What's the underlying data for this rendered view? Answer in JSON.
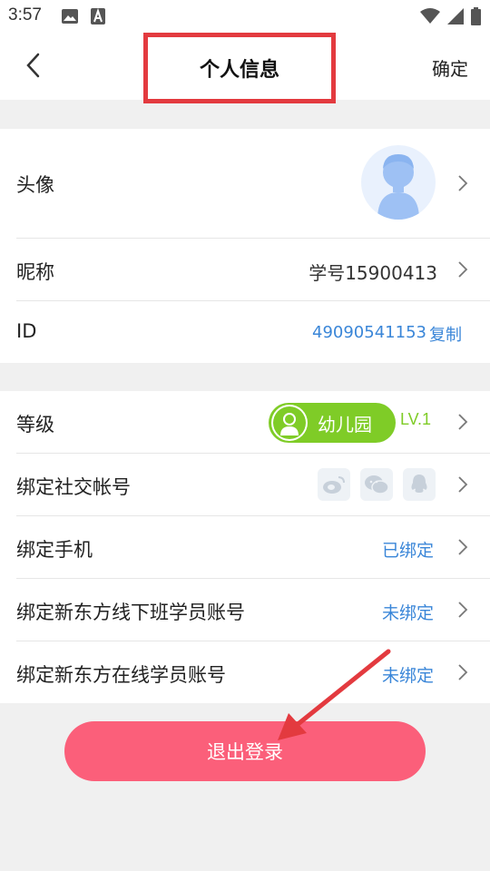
{
  "status_bar": {
    "time": "3:57",
    "left_icons": [
      "image-icon",
      "a-notification-icon"
    ],
    "right_icons": [
      "wifi-icon",
      "signal-icon",
      "battery-icon"
    ]
  },
  "navbar": {
    "title": "个人信息",
    "confirm_label": "确定"
  },
  "profile": {
    "avatar_label": "头像",
    "nickname_label": "昵称",
    "nickname_value": "学号15900413",
    "id_label": "ID",
    "id_value": "49090541153",
    "copy_label": "复制"
  },
  "account": {
    "level_label": "等级",
    "level_badge_text": "幼儿园",
    "level_value": "LV.1",
    "social_label": "绑定社交帐号",
    "social_icons": [
      "weibo-icon",
      "wechat-icon",
      "qq-icon"
    ],
    "phone_label": "绑定手机",
    "phone_status": "已绑定",
    "offline_label": "绑定新东方线下班学员账号",
    "offline_status": "未绑定",
    "online_label": "绑定新东方在线学员账号",
    "online_status": "未绑定"
  },
  "logout_label": "退出登录",
  "colors": {
    "accent_blue": "#3a86d8",
    "logout_pink": "#fb5f7a",
    "level_green": "#7fcc27",
    "annotation_red": "#e33a3f"
  }
}
